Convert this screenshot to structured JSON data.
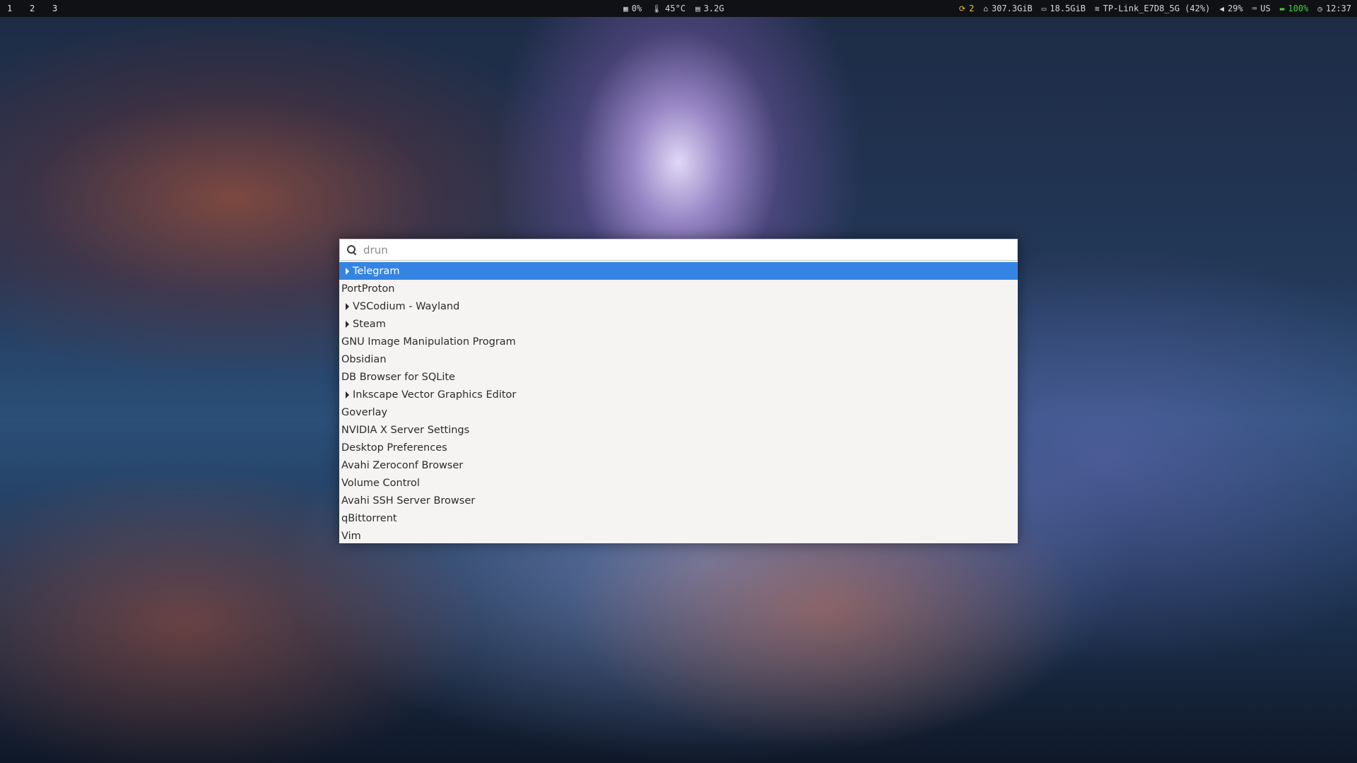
{
  "topbar": {
    "workspaces": [
      "1",
      "2",
      "3"
    ],
    "cpu": {
      "icon": "cpu-icon",
      "value": "0%"
    },
    "temperature": {
      "icon": "thermometer-icon",
      "value": "45°C"
    },
    "memory": {
      "icon": "memory-icon",
      "value": "3.2G"
    },
    "updates": {
      "icon": "sync-icon",
      "value": "2"
    },
    "home_disk": {
      "icon": "home-icon",
      "value": "307.3GiB"
    },
    "disk": {
      "icon": "disk-icon",
      "value": "18.5GiB"
    },
    "wifi": {
      "icon": "wifi-icon",
      "value": "TP-Link_E7D8_5G (42%)"
    },
    "volume": {
      "icon": "speaker-icon",
      "value": "29%"
    },
    "keyboard": {
      "icon": "keyboard-icon",
      "value": "US"
    },
    "battery": {
      "icon": "battery-icon",
      "value": "100%"
    },
    "clock": {
      "icon": "clock-icon",
      "value": "12:37"
    },
    "colors": {
      "background": "#101114",
      "updates": "#e8c341",
      "battery": "#3fcf3f"
    }
  },
  "launcher": {
    "search_placeholder": "drun",
    "search_value": "",
    "selected_color": "#3584e4",
    "items": [
      {
        "label": "Telegram",
        "has_submenu": true,
        "selected": true
      },
      {
        "label": "PortProton",
        "has_submenu": false,
        "selected": false
      },
      {
        "label": "VSCodium - Wayland",
        "has_submenu": true,
        "selected": false
      },
      {
        "label": "Steam",
        "has_submenu": true,
        "selected": false
      },
      {
        "label": "GNU Image Manipulation Program",
        "has_submenu": false,
        "selected": false
      },
      {
        "label": "Obsidian",
        "has_submenu": false,
        "selected": false
      },
      {
        "label": "DB Browser for SQLite",
        "has_submenu": false,
        "selected": false
      },
      {
        "label": "Inkscape Vector Graphics Editor",
        "has_submenu": true,
        "selected": false
      },
      {
        "label": "Goverlay",
        "has_submenu": false,
        "selected": false
      },
      {
        "label": "NVIDIA X Server Settings",
        "has_submenu": false,
        "selected": false
      },
      {
        "label": "Desktop Preferences",
        "has_submenu": false,
        "selected": false
      },
      {
        "label": "Avahi Zeroconf Browser",
        "has_submenu": false,
        "selected": false
      },
      {
        "label": "Volume Control",
        "has_submenu": false,
        "selected": false
      },
      {
        "label": "Avahi SSH Server Browser",
        "has_submenu": false,
        "selected": false
      },
      {
        "label": "qBittorrent",
        "has_submenu": false,
        "selected": false
      },
      {
        "label": "Vim",
        "has_submenu": false,
        "selected": false
      }
    ]
  }
}
